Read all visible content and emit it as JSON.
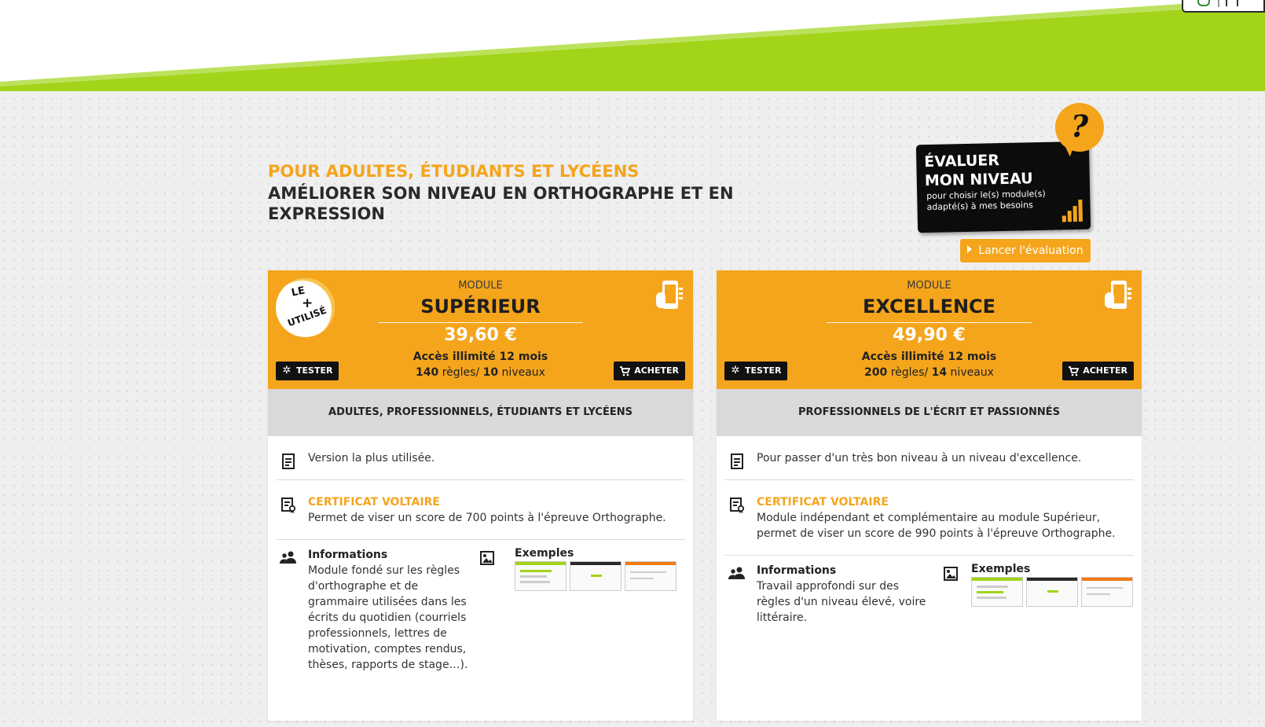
{
  "heading": {
    "subtitle": "POUR ADULTES, ÉTUDIANTS ET LYCÉENS",
    "title": "AMÉLIORER SON NIVEAU EN ORTHOGRAPHE ET EN EXPRESSION"
  },
  "evaluation": {
    "title_line1": "ÉVALUER",
    "title_line2": "MON NIVEAU",
    "description": "pour choisir le(s) module(s) adapté(s) à mes besoins",
    "question_mark": "?",
    "launch_label": "Lancer l'évaluation"
  },
  "cards": [
    {
      "module_label": "MODULE",
      "name": "SUPÉRIEUR",
      "price": "39,60 €",
      "access": "Accès illimité 12 mois",
      "rules_count": "140",
      "rules_text": " règles/ ",
      "levels_count": "10",
      "levels_text": " niveaux",
      "tester_label": "TESTER",
      "buy_label": "ACHETER",
      "badge": {
        "line1": "LE",
        "line2": "+",
        "line3": "UTILISÉ"
      },
      "audience": "ADULTES, PROFESSIONNELS, ÉTUDIANTS ET LYCÉENS",
      "description": "Version la plus utilisée.",
      "certificate_label": "CERTIFICAT VOLTAIRE",
      "certificate_text": "Permet de viser un score de 700 points à l'épreuve Orthographe.",
      "info_title": "Informations",
      "info_text": "Module fondé sur les règles d'orthographe et de grammaire utilisées dans les écrits du quotidien (courriels professionnels, lettres de motivation, comptes rendus, thèses, rapports de stage…).",
      "examples_title": "Exemples"
    },
    {
      "module_label": "MODULE",
      "name": "EXCELLENCE",
      "price": "49,90 €",
      "access": "Accès illimité 12 mois",
      "rules_count": "200",
      "rules_text": " règles/ ",
      "levels_count": "14",
      "levels_text": " niveaux",
      "tester_label": "TESTER",
      "buy_label": "ACHETER",
      "audience": "PROFESSIONNELS DE L'ÉCRIT ET PASSIONNÉS",
      "description": "Pour passer d'un très bon niveau à un niveau d'excellence.",
      "certificate_label": "CERTIFICAT VOLTAIRE",
      "certificate_text": "Module indépendant et complémentaire au module Supérieur, permet de viser un score de 990 points à l'épreuve Orthographe.",
      "info_title": "Informations",
      "info_text": "Travail approfondi sur des règles d'un niveau élevé, voire littéraire.",
      "examples_title": "Exemples"
    }
  ],
  "colors": {
    "accent": "#f5a51c",
    "green": "#a2d41a",
    "dark": "#111111",
    "band": "#d9d9d9"
  },
  "icons": [
    "phone-icon",
    "tester-icon",
    "cart-icon",
    "document-icon",
    "certificate-icon",
    "users-icon",
    "image-icon",
    "play-icon",
    "signal-bars-icon"
  ]
}
